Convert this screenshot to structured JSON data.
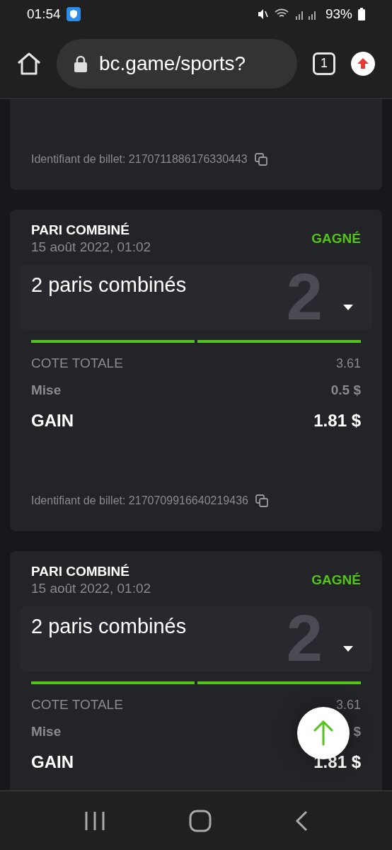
{
  "status_bar": {
    "time": "01:54",
    "battery": "93%"
  },
  "browser": {
    "url": "bc.game/sports?",
    "tab_count": "1"
  },
  "tickets": [
    {
      "kind": "partial",
      "ticket_id": "Identifiant de billet: 2170711886176330443"
    },
    {
      "kind": "full",
      "type": "PARI COMBINÉ",
      "date": "15 août 2022, 01:02",
      "result": "GAGNÉ",
      "summary": "2 paris combinés",
      "count": "2",
      "expanded": false,
      "legs": [
        {
          "won": true
        },
        {
          "won": true
        }
      ],
      "odds_label": "COTE TOTALE",
      "odds": "3.61",
      "stake_label": "Mise",
      "stake": "0.5 $",
      "gain_label": "GAIN",
      "gain": "1.81 $",
      "ticket_id": "Identifiant de billet: 2170709916640219436"
    },
    {
      "kind": "full",
      "type": "PARI COMBINÉ",
      "date": "15 août 2022, 01:02",
      "result": "GAGNÉ",
      "summary": "2 paris combinés",
      "count": "2",
      "expanded": false,
      "legs": [
        {
          "won": true
        },
        {
          "won": true
        }
      ],
      "odds_label": "COTE TOTALE",
      "odds": "3.61",
      "stake_label": "Mise",
      "stake": "$",
      "gain_label": "GAIN",
      "gain": "1.81 $"
    }
  ]
}
